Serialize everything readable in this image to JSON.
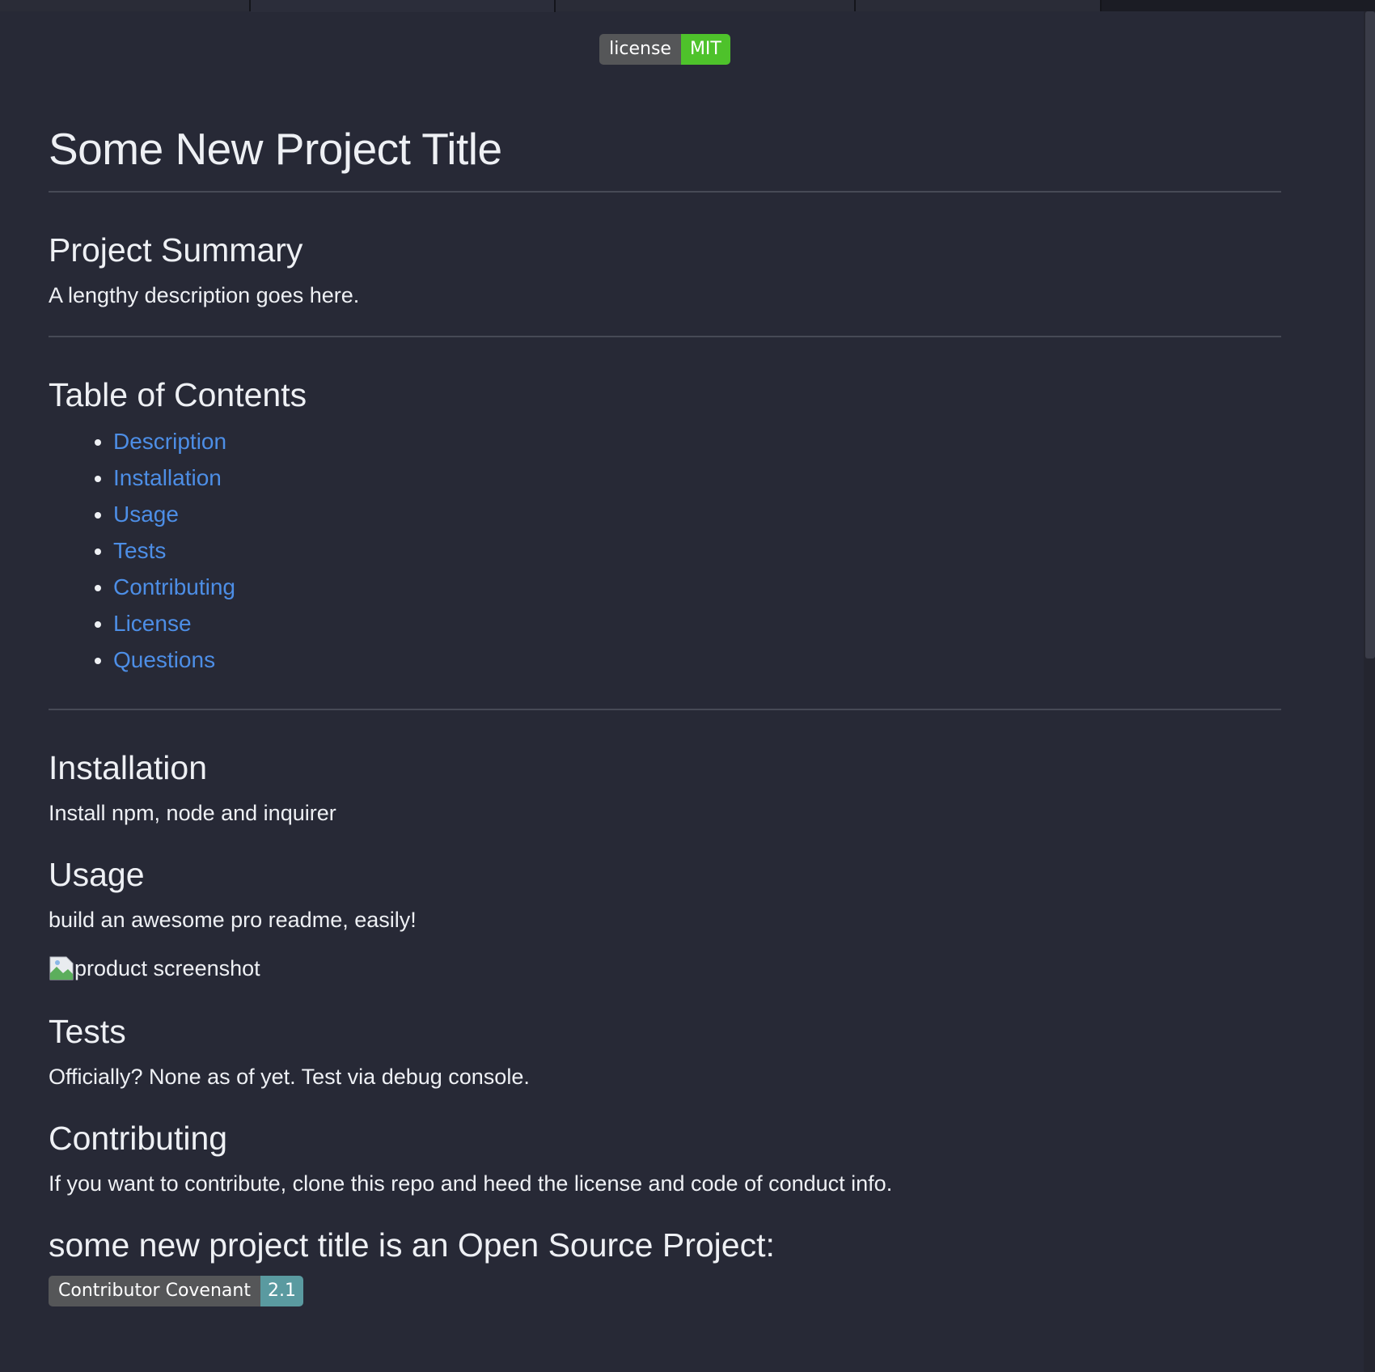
{
  "license_badge": {
    "label": "license",
    "value": "MIT",
    "color": "#4ec22b"
  },
  "title": "Some New Project Title",
  "summary": {
    "heading": "Project Summary",
    "text": "A lengthy description goes here."
  },
  "toc": {
    "heading": "Table of Contents",
    "items": [
      "Description",
      "Installation",
      "Usage",
      "Tests",
      "Contributing",
      "License",
      "Questions"
    ]
  },
  "installation": {
    "heading": "Installation",
    "text": "Install npm, node and inquirer"
  },
  "usage": {
    "heading": "Usage",
    "text": "build an awesome pro readme, easily!",
    "image_alt": "product screenshot"
  },
  "tests": {
    "heading": "Tests",
    "text": "Officially? None as of yet. Test via debug console."
  },
  "contributing": {
    "heading": "Contributing",
    "text": "If you want to contribute, clone this repo and heed the license and code of conduct info."
  },
  "open_source": {
    "heading": "some new project title is an Open Source Project:"
  },
  "covenant_badge": {
    "label": "Contributor Covenant",
    "value": "2.1",
    "color": "#5a9aa0"
  },
  "colors": {
    "background": "#272936",
    "link": "#4d8ee6",
    "text": "#eef0f4"
  }
}
